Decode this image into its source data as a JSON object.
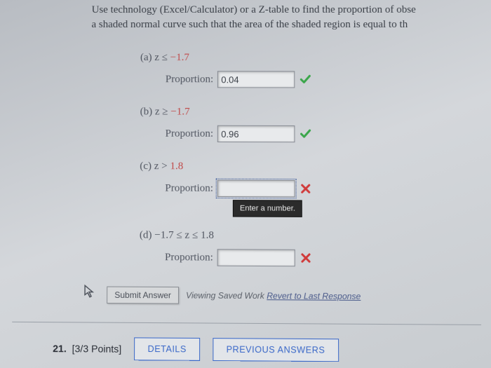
{
  "instructions_line1": "Use technology (Excel/Calculator) or a Z-table to find the proportion of obse",
  "instructions_line2": "a shaded normal curve such that the area of the shaded region is equal to th",
  "parts": {
    "a": {
      "label_prefix": "(a)  z ≤ ",
      "value": "−1.7",
      "prop_label": "Proportion:",
      "input": "0.04",
      "status": "correct"
    },
    "b": {
      "label_prefix": "(b)  z ≥ ",
      "value": "−1.7",
      "prop_label": "Proportion:",
      "input": "0.96",
      "status": "correct"
    },
    "c": {
      "label_prefix": "(c)  z > ",
      "value": "1.8",
      "prop_label": "Proportion:",
      "input": "",
      "status": "wrong",
      "tooltip": "Enter a number."
    },
    "d": {
      "label_full": "(d)  −1.7 ≤ z ≤ 1.8",
      "prop_label": "Proportion:",
      "input": "",
      "status": "wrong"
    }
  },
  "submit_label": "Submit Answer",
  "saved_work_prefix": "Viewing Saved Work ",
  "saved_work_link": "Revert to Last Response",
  "question_number": "21.",
  "question_points": "[3/3 Points]",
  "details_btn": "DETAILS",
  "previous_btn": "PREVIOUS ANSWERS"
}
